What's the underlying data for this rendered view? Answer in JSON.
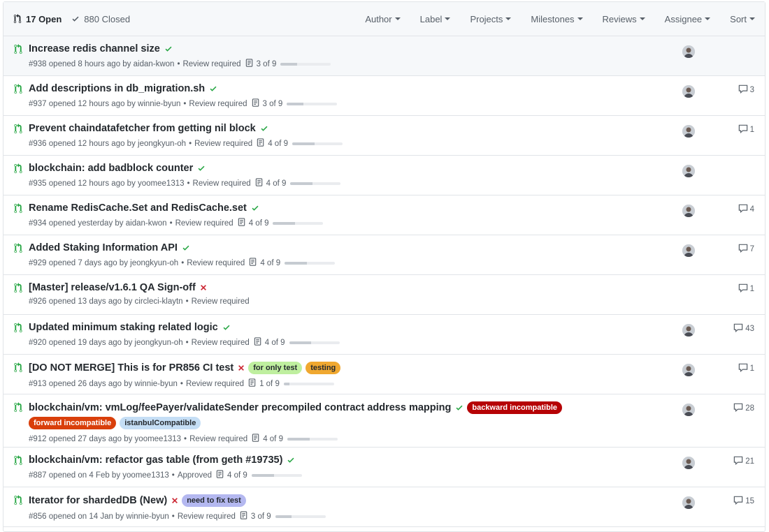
{
  "header": {
    "open_label": "17 Open",
    "closed_label": "880 Closed",
    "filters": [
      {
        "label": "Author"
      },
      {
        "label": "Label"
      },
      {
        "label": "Projects"
      },
      {
        "label": "Milestones"
      },
      {
        "label": "Reviews"
      },
      {
        "label": "Assignee"
      },
      {
        "label": "Sort"
      }
    ]
  },
  "colors": {
    "pr_open": "#28a745",
    "success": "#28a745",
    "failure": "#cb2431",
    "meta_text": "#586069"
  },
  "pull_requests": [
    {
      "title": "Increase redis channel size",
      "status": "success",
      "meta": "#938 opened 8 hours ago by aidan-kwon",
      "review": "Review required",
      "tasks": "3 of 9",
      "task_progress": 0.33,
      "comments": "",
      "avatar": "avatar-aidan",
      "labels": [],
      "extra_labels": []
    },
    {
      "title": "Add descriptions in db_migration.sh",
      "status": "success",
      "meta": "#937 opened 12 hours ago by winnie-byun",
      "review": "Review required",
      "tasks": "3 of 9",
      "task_progress": 0.33,
      "comments": "3",
      "avatar": "avatar-winnie",
      "labels": [],
      "extra_labels": []
    },
    {
      "title": "Prevent chaindatafetcher from getting nil block",
      "status": "success",
      "meta": "#936 opened 12 hours ago by jeongkyun-oh",
      "review": "Review required",
      "tasks": "4 of 9",
      "task_progress": 0.44,
      "comments": "1",
      "avatar": "avatar-jeongkyun",
      "labels": [],
      "extra_labels": []
    },
    {
      "title": "blockchain: add badblock counter",
      "status": "success",
      "meta": "#935 opened 12 hours ago by yoomee1313",
      "review": "Review required",
      "tasks": "4 of 9",
      "task_progress": 0.44,
      "comments": "",
      "avatar": "avatar-yoomee",
      "labels": [],
      "extra_labels": []
    },
    {
      "title": "Rename RedisCache.Set and RedisCache.set",
      "status": "success",
      "meta": "#934 opened yesterday by aidan-kwon",
      "review": "Review required",
      "tasks": "4 of 9",
      "task_progress": 0.44,
      "comments": "4",
      "avatar": "avatar-aidan",
      "labels": [],
      "extra_labels": []
    },
    {
      "title": "Added Staking Information API",
      "status": "success",
      "meta": "#929 opened 7 days ago by jeongkyun-oh",
      "review": "Review required",
      "tasks": "4 of 9",
      "task_progress": 0.44,
      "comments": "7",
      "avatar": "avatar-jeongkyun",
      "labels": [],
      "extra_labels": []
    },
    {
      "title": "[Master] release/v1.6.1 QA Sign-off",
      "status": "failure",
      "meta": "#926 opened 13 days ago by circleci-klaytn",
      "review": "Review required",
      "tasks": "",
      "task_progress": null,
      "comments": "1",
      "avatar": "",
      "labels": [],
      "extra_labels": []
    },
    {
      "title": "Updated minimum staking related logic",
      "status": "success",
      "meta": "#920 opened 19 days ago by jeongkyun-oh",
      "review": "Review required",
      "tasks": "4 of 9",
      "task_progress": 0.44,
      "comments": "43",
      "avatar": "avatar-jeongkyun",
      "labels": [],
      "extra_labels": []
    },
    {
      "title": "[DO NOT MERGE] This is for PR856 CI test",
      "status": "failure",
      "meta": "#913 opened 26 days ago by winnie-byun",
      "review": "Review required",
      "tasks": "1 of 9",
      "task_progress": 0.11,
      "comments": "1",
      "avatar": "avatar-winnie",
      "labels": [
        {
          "name": "for only test",
          "bg": "#bfef9f",
          "fg": "#24292e"
        },
        {
          "name": "testing",
          "bg": "#f0a830",
          "fg": "#24292e"
        }
      ],
      "extra_labels": []
    },
    {
      "title": "blockchain/vm: vmLog/feePayer/validateSender precompiled contract address mapping",
      "status": "success",
      "meta": "#912 opened 27 days ago by yoomee1313",
      "review": "Review required",
      "tasks": "4 of 9",
      "task_progress": 0.44,
      "comments": "28",
      "avatar": "avatar-yoomee",
      "labels": [
        {
          "name": "backward incompatible",
          "bg": "#b60205",
          "fg": "#ffffff"
        }
      ],
      "extra_labels": [
        {
          "name": "forward incompatible",
          "bg": "#d93f0b",
          "fg": "#ffffff"
        },
        {
          "name": "istanbulCompatible",
          "bg": "#c5def5",
          "fg": "#24292e"
        }
      ]
    },
    {
      "title": "blockchain/vm: refactor gas table (from geth #19735)",
      "status": "success",
      "meta": "#887 opened on 4 Feb by yoomee1313",
      "review": "Approved",
      "tasks": "4 of 9",
      "task_progress": 0.44,
      "comments": "21",
      "avatar": "avatar-yoomee",
      "labels": [],
      "extra_labels": []
    },
    {
      "title": "Iterator for shardedDB (New)",
      "status": "failure",
      "meta": "#856 opened on 14 Jan by winnie-byun",
      "review": "Review required",
      "tasks": "3 of 9",
      "task_progress": 0.33,
      "comments": "15",
      "avatar": "avatar-winnie",
      "labels": [
        {
          "name": "need to fix test",
          "bg": "#b4b8f0",
          "fg": "#24292e"
        }
      ],
      "extra_labels": []
    }
  ]
}
